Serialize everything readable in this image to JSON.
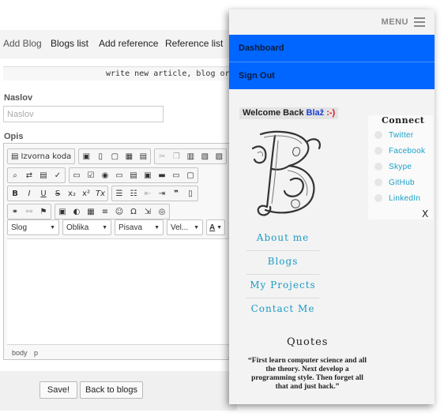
{
  "topnav": {
    "items": [
      "Add Blog",
      "Blogs list",
      "Add reference",
      "Reference list"
    ]
  },
  "banner": {
    "text": "write new article, blog or new"
  },
  "form": {
    "title_label": "Naslov",
    "title_placeholder": "Naslov",
    "body_label": "Opis",
    "save_label": "Save!",
    "back_label": "Back to blogs"
  },
  "editor": {
    "source_label": "Izvorna koda",
    "combos": {
      "format": "Slog",
      "shape": "Oblika",
      "font": "Pisava",
      "size": "Vel...",
      "text_color": "A"
    },
    "path": [
      "body",
      "p"
    ]
  },
  "panel": {
    "menu_label": "MENU",
    "nav": [
      "Dashboard",
      "Sign Out"
    ],
    "welcome_prefix": "Welcome Back",
    "username": "Blaž",
    "smiley": ":-)",
    "connect_title": "Connect",
    "social": [
      "Twitter",
      "Facebook",
      "Skype",
      "GitHub",
      "LinkedIn"
    ],
    "close": "X",
    "links": [
      "About me",
      "Blogs",
      "My Projects",
      "Contact Me"
    ],
    "quotes_title": "Quotes",
    "quote": "“First learn computer science and all the theory. Next develop a programming style. Then forget all that and just hack.”"
  },
  "colors": {
    "nav_blue": "#0066ff",
    "link_teal": "#1a9bc4",
    "username_blue": "#1a3fd6",
    "smiley_red": "#e0141e"
  },
  "icons": {
    "toolbar_row1": [
      "source-icon",
      "save-icon",
      "new-page-icon",
      "preview-icon",
      "print-icon",
      "templates-icon",
      "cut-icon",
      "copy-icon",
      "paste-icon",
      "paste-text-icon",
      "paste-word-icon"
    ],
    "toolbar_row2": [
      "find-icon",
      "replace-icon",
      "select-all-icon",
      "spellcheck-icon",
      "form-icon",
      "checkbox-icon",
      "radio-icon",
      "textfield-icon",
      "textarea-icon",
      "select-field-icon",
      "button-icon",
      "image-button-icon",
      "hidden-field-icon"
    ],
    "toolbar_row3": [
      "bold-icon",
      "italic-icon",
      "underline-icon",
      "strike-icon",
      "subscript-icon",
      "superscript-icon",
      "remove-format-icon",
      "numbered-list-icon",
      "bulleted-list-icon",
      "outdent-icon",
      "indent-icon",
      "blockquote-icon",
      "div-icon"
    ],
    "toolbar_row4": [
      "link-icon",
      "unlink-icon",
      "anchor-icon",
      "image-icon",
      "flash-icon",
      "table-icon",
      "horizontal-line-icon",
      "smiley-icon",
      "special-char-icon",
      "page-break-icon",
      "iframe-icon"
    ]
  }
}
